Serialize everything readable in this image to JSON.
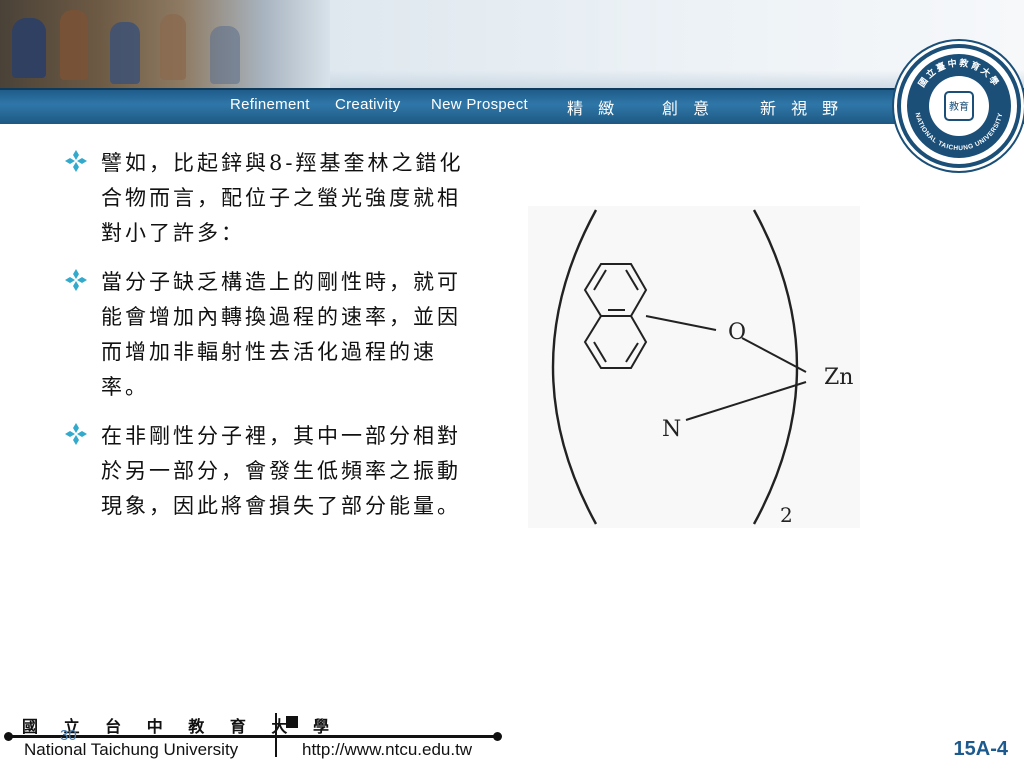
{
  "header": {
    "taglines_en": [
      "Refinement",
      "Creativity",
      "New Prospect"
    ],
    "taglines_cn": [
      "精 緻",
      "創 意",
      "新 視 野"
    ],
    "seal": {
      "ring_text_top": "國立臺中教育大學",
      "ring_text_bottom": "NATIONAL TAICHUNG UNIVERSITY",
      "center_text": "教育"
    }
  },
  "bullets": [
    {
      "icon": "diamond-bullet-icon",
      "text": "譬如，比起鋅與8-羥基奎林之錯化合物而言，配位子之螢光強度就相對小了許多："
    },
    {
      "icon": "diamond-bullet-icon",
      "text": "當分子缺乏構造上的剛性時，就可能會增加內轉換過程的速率，並因而增加非輻射性去活化過程的速率。"
    },
    {
      "icon": "diamond-bullet-icon",
      "text": "在非剛性分子裡，其中一部分相對於另一部分，會發生低頻率之振動現象，因此將會損失了部分能量。"
    }
  ],
  "figure": {
    "atom_o": "O",
    "atom_n": "N",
    "metal": "Zn",
    "subscript": "2"
  },
  "footer": {
    "university_cn": "國 立 台 中 教 育 大 學",
    "university_en": "National Taichung University",
    "url": "http://www.ntcu.edu.tw",
    "page_number": "30",
    "slide_code": "15A-4"
  },
  "colors": {
    "banner_blue": "#1f5c8a",
    "bullet_teal": "#33aacc",
    "slide_code_blue": "#1c5a8e"
  }
}
